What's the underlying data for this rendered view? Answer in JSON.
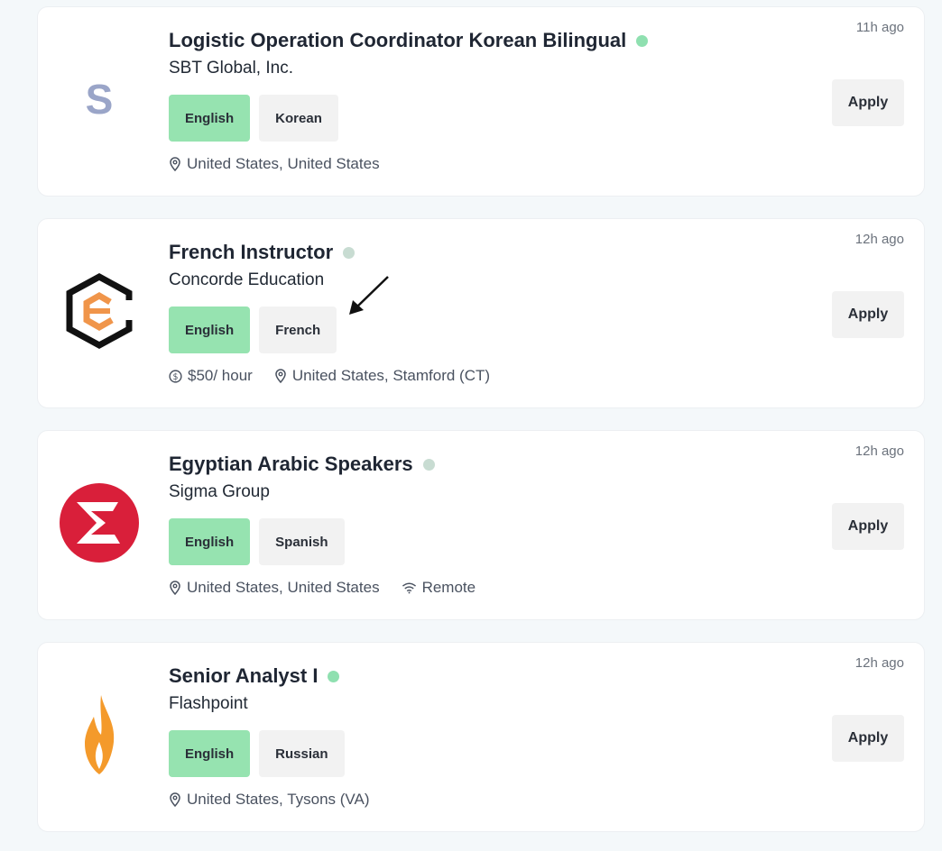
{
  "jobs": [
    {
      "title": "Logistic Operation Coordinator Korean Bilingual",
      "company": "SBT Global, Inc.",
      "tags": [
        "English",
        "Korean"
      ],
      "location": "United States, United States",
      "time": "11h ago",
      "apply_label": "Apply",
      "logo_letter": "S",
      "dot_color": "#8fe0b0"
    },
    {
      "title": "French Instructor",
      "company": "Concorde Education",
      "tags": [
        "English",
        "French"
      ],
      "salary": "$50/ hour",
      "location": "United States, Stamford (CT)",
      "time": "12h ago",
      "apply_label": "Apply",
      "dot_color": "#c8dcd2"
    },
    {
      "title": "Egyptian Arabic Speakers",
      "company": "Sigma Group",
      "tags": [
        "English",
        "Spanish"
      ],
      "location": "United States, United States",
      "remote": "Remote",
      "time": "12h ago",
      "apply_label": "Apply",
      "dot_color": "#c8dcd2"
    },
    {
      "title": "Senior Analyst I",
      "company": "Flashpoint",
      "tags": [
        "English",
        "Russian"
      ],
      "location": "United States, Tysons (VA)",
      "time": "12h ago",
      "apply_label": "Apply",
      "dot_color": "#8fe0b0"
    }
  ],
  "colors": {
    "tag_primary": "#96e3b0",
    "tag_secondary": "#f2f2f2"
  }
}
